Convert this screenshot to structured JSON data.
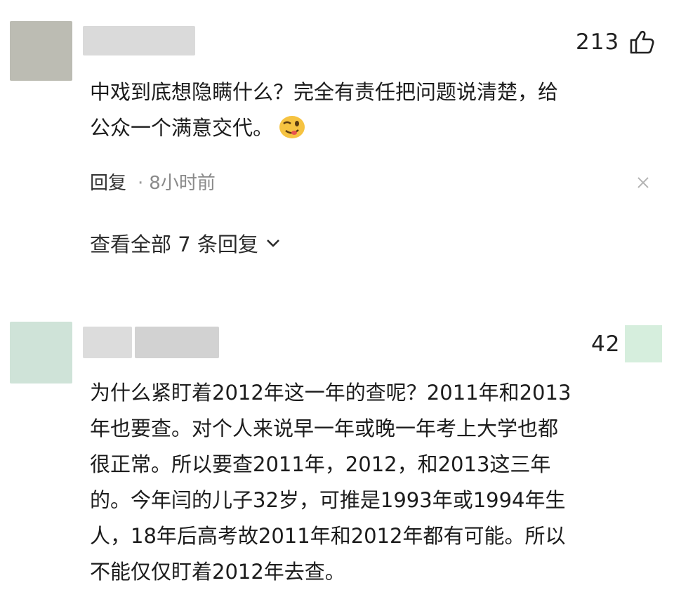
{
  "comments": [
    {
      "likes": "213",
      "text": "中戏到底想隐瞒什么？完全有责任把问题说清楚，给\n公众一个满意交代。",
      "emoji": "wink-tongue-emoji",
      "reply_label": "回复",
      "separator": "·",
      "time": "8小时前",
      "view_replies": "查看全部 7 条回复"
    },
    {
      "likes": "42",
      "text": "为什么紧盯着2012年这一年的查呢？2011年和2013\n年也要查。对个人来说早一年或晚一年考上大学也都\n很正常。所以要查2011年，2012，和2013这三年\n的。今年闫的儿子32岁，可推是1993年或1994年生\n人，18年后高考故2011年和2012年都有可能。所以\n不能仅仅盯着2012年去查。"
    }
  ],
  "colors": {
    "avatar1": "#bcbcb3",
    "name1": "#d9d9d9",
    "avatar2": "#cfe3d8",
    "name2a": "#dcdcdc",
    "name2b": "#d2d2d2",
    "like_box2": "#d6eedd"
  },
  "icons": [
    "thumbs-up-icon",
    "close-icon",
    "chevron-down-icon"
  ]
}
